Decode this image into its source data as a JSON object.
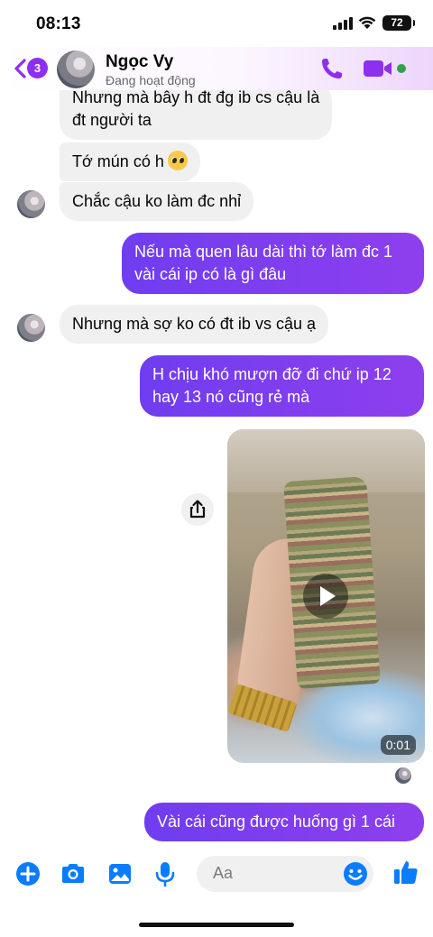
{
  "status_bar": {
    "time": "08:13",
    "battery": "72"
  },
  "header": {
    "unread_count": "3",
    "name": "Ngọc Vy",
    "status": "Đang hoạt động"
  },
  "messages": [
    {
      "side": "in",
      "text_line1": "Nhưng mà bây h đt đg ib cs cậu là",
      "text_line2": "đt người ta"
    },
    {
      "side": "in",
      "text": "Tớ mún có h"
    },
    {
      "side": "in",
      "text": "Chắc cậu ko làm đc nhỉ"
    },
    {
      "side": "out",
      "text_line1": "Nếu mà quen lâu dài thì tớ làm đc 1",
      "text_line2": "vài cái ip có là gì đâu"
    },
    {
      "side": "in",
      "text": "Nhưng mà sợ ko có đt ib vs cậu ạ"
    },
    {
      "side": "out",
      "text_line1": "H chịu khó mượn đỡ đi chứ ip 12",
      "text_line2": "hay 13 nó cũng rẻ mà"
    },
    {
      "side": "in",
      "type": "video",
      "duration": "0:01"
    },
    {
      "side": "out",
      "text": "Vài cái cũng được huống gì 1 cái"
    }
  ],
  "composer": {
    "placeholder": "Aa"
  },
  "colors": {
    "accent": "#8e2ff0",
    "outgoing_bubble": "#7b2ff2",
    "incoming_bubble": "#f0f0f0",
    "online": "#31a24c",
    "composer_icon": "#0a7cff"
  },
  "icons": [
    "back-chevron-icon",
    "phone-icon",
    "video-camera-icon",
    "share-icon",
    "play-icon",
    "plus-icon",
    "camera-icon",
    "gallery-icon",
    "microphone-icon",
    "emoji-icon",
    "thumbs-up-icon"
  ]
}
